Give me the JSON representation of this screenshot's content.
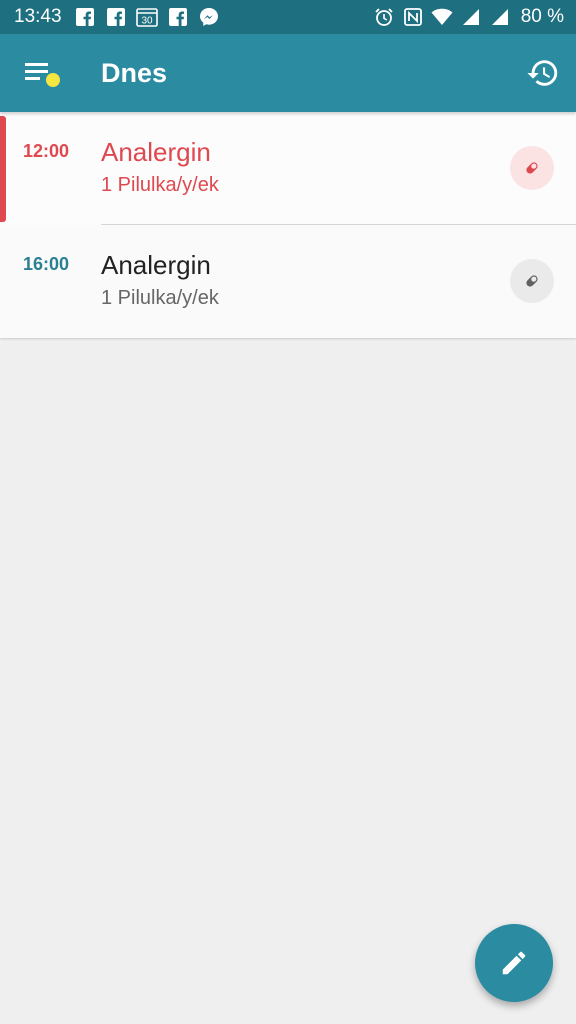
{
  "status_bar": {
    "time": "13:43",
    "notification_icons": [
      "facebook-icon",
      "facebook-icon",
      "calendar-30-icon",
      "facebook-icon",
      "messenger-icon"
    ],
    "calendar_day": "30",
    "system_icons": [
      "alarm-icon",
      "nfc-icon",
      "wifi-icon",
      "signal-icon",
      "signal-icon"
    ],
    "battery": "80 %"
  },
  "app_bar": {
    "title": "Dnes",
    "menu_icon": "menu-with-badge-icon",
    "history_icon": "history-icon"
  },
  "doses": [
    {
      "time": "12:00",
      "medication": "Analergin",
      "amount": "1 Pilulka/y/ek",
      "state": "current",
      "icon": "pill-icon"
    },
    {
      "time": "16:00",
      "medication": "Analergin",
      "amount": "1 Pilulka/y/ek",
      "state": "upcoming",
      "icon": "pill-icon"
    }
  ],
  "fab": {
    "icon": "pencil-icon"
  },
  "colors": {
    "status_bar": "#1e6f7f",
    "app_bar": "#2a8ba1",
    "accent_red": "#e0484f",
    "time_teal": "#2a7f91",
    "badge_yellow": "#f5e642",
    "background": "#efeff0"
  }
}
